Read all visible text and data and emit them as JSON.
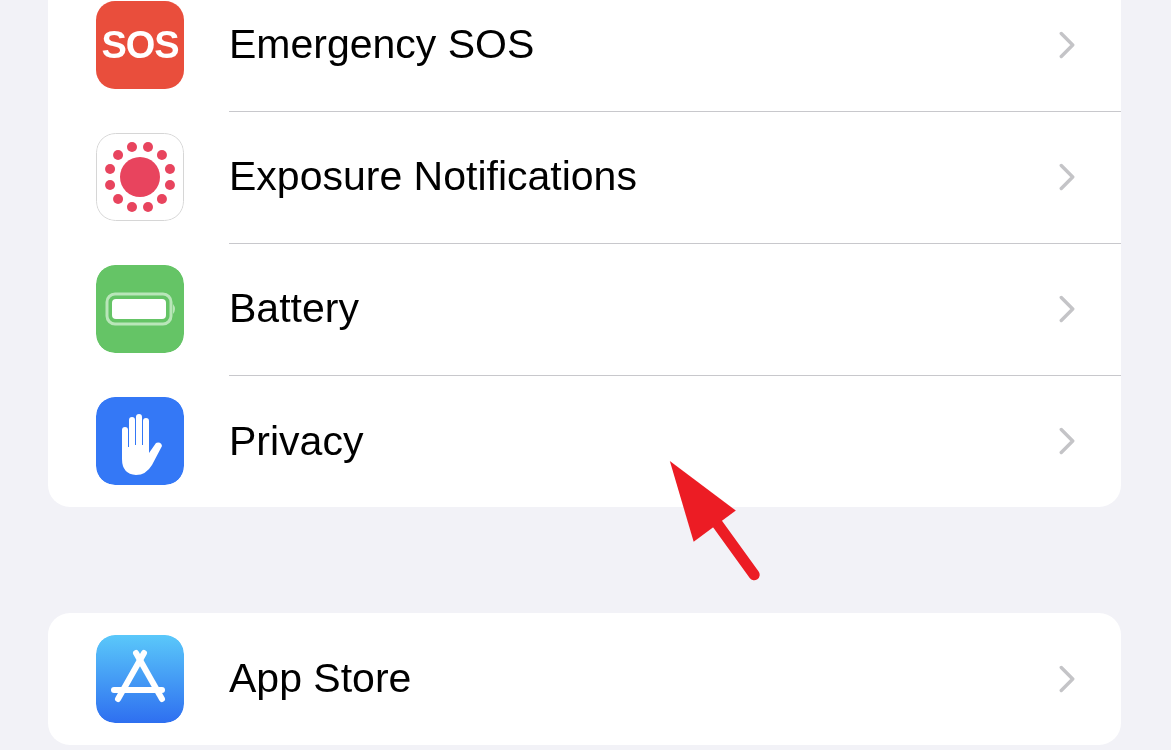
{
  "groups": [
    {
      "items": [
        {
          "kind": "sos",
          "icon_text": "SOS",
          "label": "Emergency SOS"
        },
        {
          "kind": "exposure",
          "label": "Exposure Notifications"
        },
        {
          "kind": "battery",
          "label": "Battery"
        },
        {
          "kind": "privacy",
          "label": "Privacy"
        }
      ]
    },
    {
      "items": [
        {
          "kind": "appstore",
          "label": "App Store"
        }
      ]
    }
  ]
}
